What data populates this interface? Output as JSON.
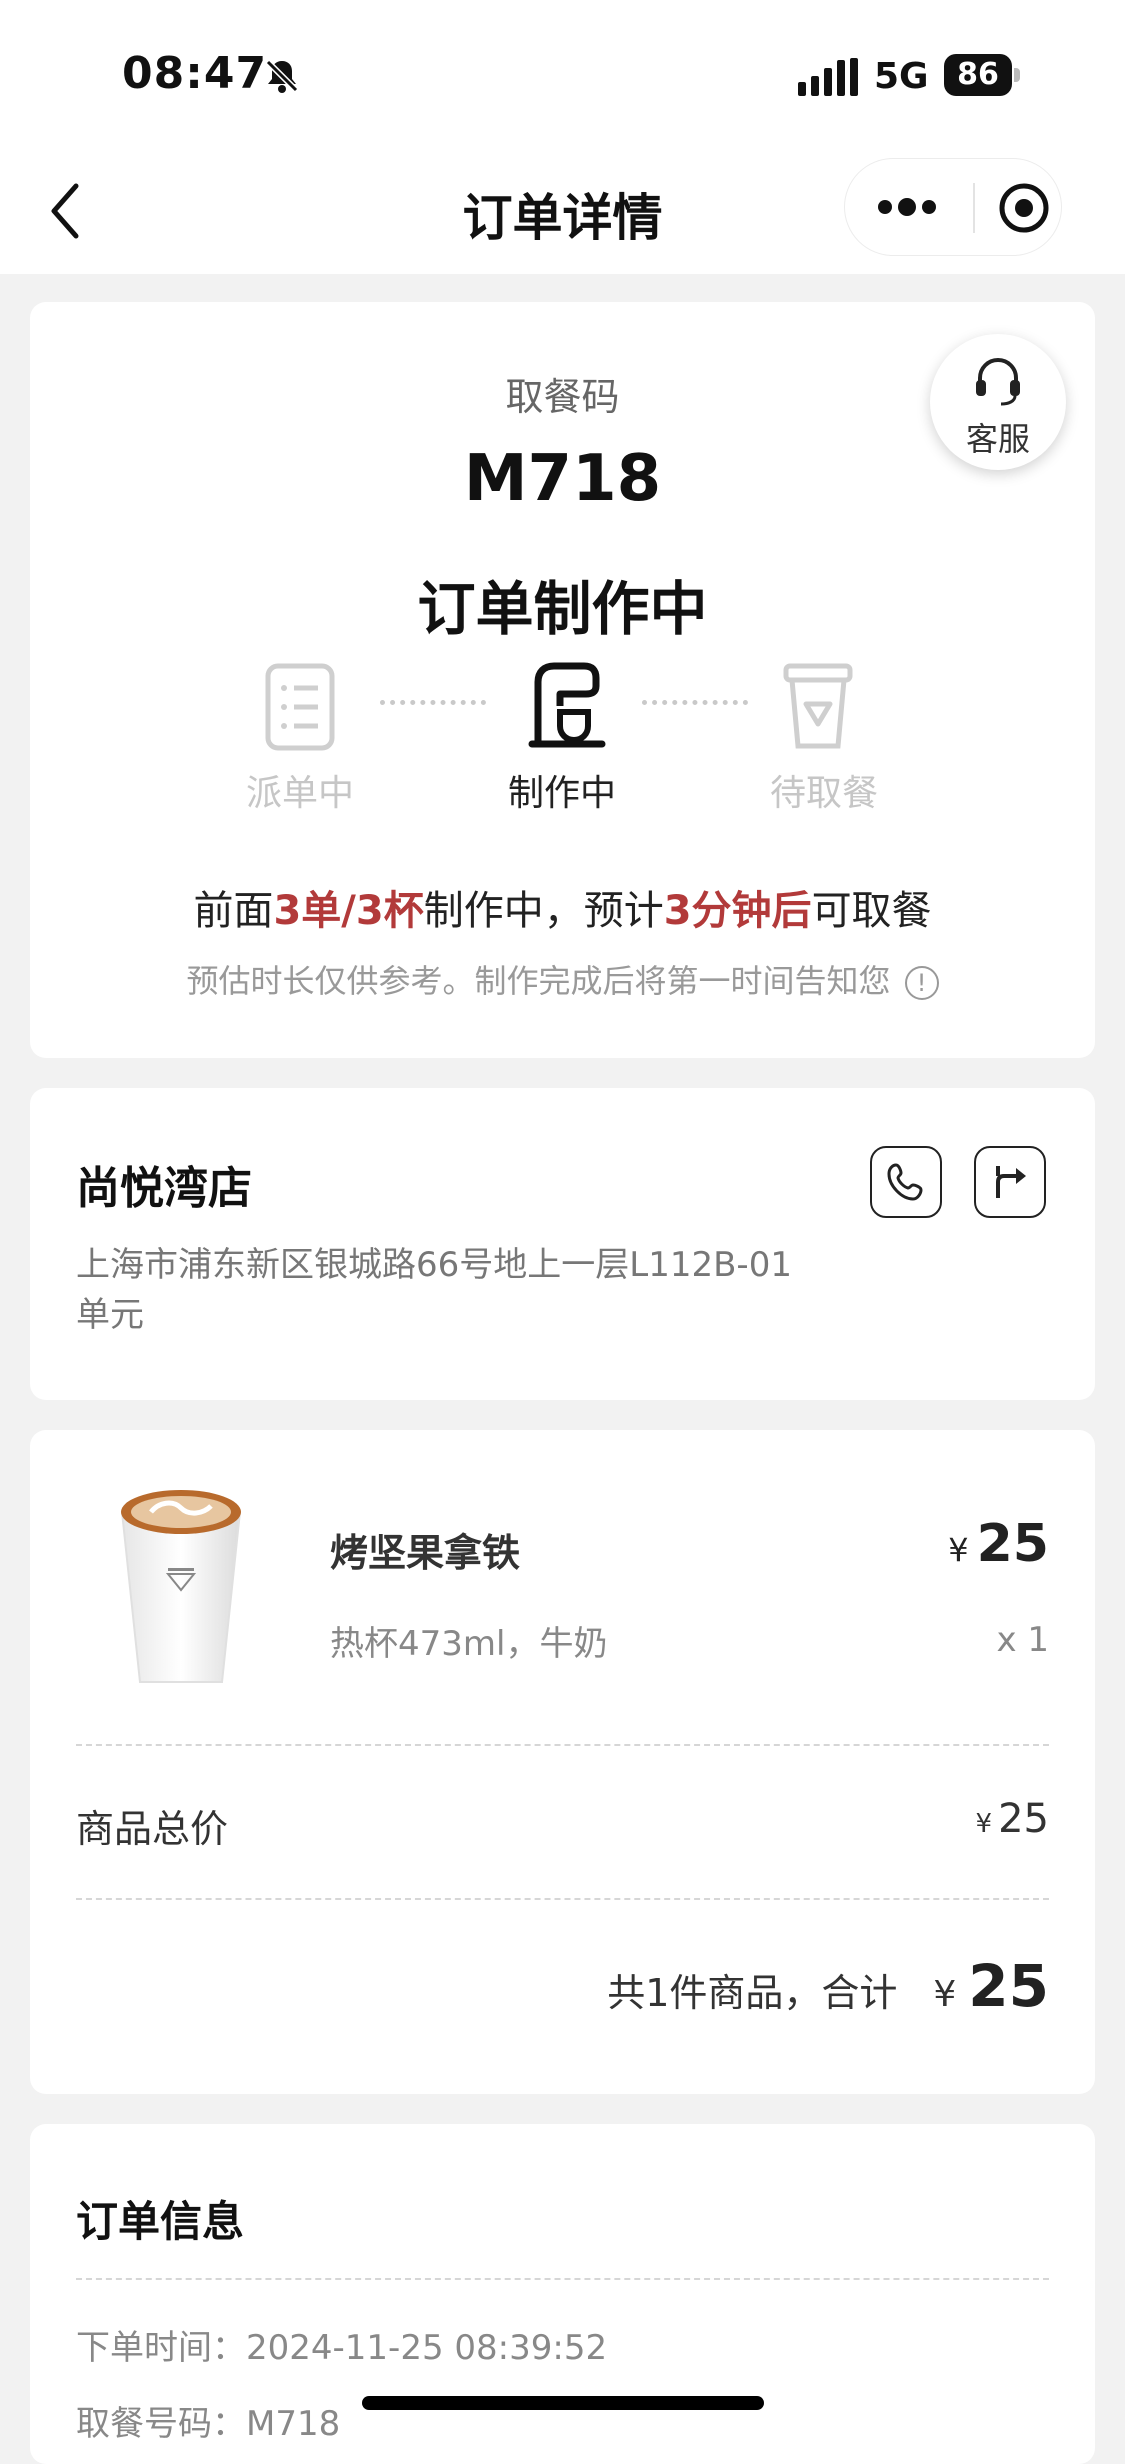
{
  "status_bar": {
    "time": "08:47",
    "network": "5G",
    "battery": "86"
  },
  "nav": {
    "title": "订单详情"
  },
  "pickup": {
    "label": "取餐码",
    "code": "M718",
    "status": "订单制作中",
    "service_label": "客服",
    "steps": [
      {
        "label": "派单中",
        "icon": "list-icon",
        "active": false
      },
      {
        "label": "制作中",
        "icon": "coffee-machine-icon",
        "active": true
      },
      {
        "label": "待取餐",
        "icon": "cup-icon",
        "active": false
      }
    ],
    "wait": {
      "p1": "前面",
      "h1": "3单/3杯",
      "p2": "制作中，预计",
      "h2": "3分钟后",
      "p3": "可取餐"
    },
    "note": "预估时长仅供参考。制作完成后将第一时间告知您",
    "highlight_color": "#b23a3a"
  },
  "store": {
    "name": "尚悦湾店",
    "address": "上海市浦东新区银城路66号地上一层L112B-01单元"
  },
  "order_items": [
    {
      "name": "烤坚果拿铁",
      "spec": "热杯473ml，牛奶",
      "currency": "¥",
      "price": "25",
      "qty": "x 1"
    }
  ],
  "summary": {
    "subtotal_label": "商品总价",
    "subtotal_currency": "¥",
    "subtotal_value": "25",
    "total_text": "共1件商品，合计",
    "total_currency": "¥",
    "total_value": "25"
  },
  "order_info": {
    "title": "订单信息",
    "order_time": "下单时间：2024-11-25 08:39:52",
    "pickup_no": "取餐号码：M718"
  }
}
